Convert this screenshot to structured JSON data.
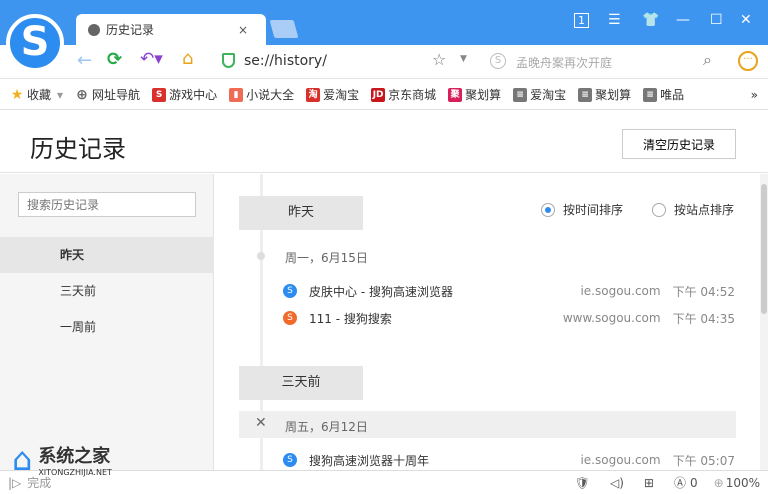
{
  "tab": {
    "title": "历史记录",
    "close": "×"
  },
  "window": {
    "tab_count": "1",
    "menu": "☰",
    "skin": "👕",
    "min": "—",
    "max": "☐",
    "close": "✕"
  },
  "address": {
    "url": "se://history/",
    "search_placeholder": "孟晚舟案再次开庭"
  },
  "bookmarks": [
    {
      "label": "收藏",
      "icon": "star-icon",
      "color": "#f2b01e",
      "glyph": "★"
    },
    {
      "label": "网址导航",
      "icon": "globe-icon",
      "color": "#666",
      "glyph": "⊕"
    },
    {
      "label": "游戏中心",
      "icon": "game-icon",
      "color": "#d9302c",
      "glyph": "S"
    },
    {
      "label": "小说大全",
      "icon": "novel-icon",
      "color": "#f06b55",
      "glyph": "▮"
    },
    {
      "label": "爱淘宝",
      "icon": "taobao-icon",
      "color": "#d9302c",
      "glyph": "淘"
    },
    {
      "label": "京东商城",
      "icon": "jd-icon",
      "color": "#c8161d",
      "glyph": "JD"
    },
    {
      "label": "聚划算",
      "icon": "juhuasuan-icon",
      "color": "#d81e5b",
      "glyph": "聚"
    },
    {
      "label": "爱淘宝",
      "icon": "page-icon",
      "color": "#777",
      "glyph": "≡"
    },
    {
      "label": "聚划算",
      "icon": "page-icon",
      "color": "#777",
      "glyph": "≡"
    },
    {
      "label": "唯品",
      "icon": "page-icon",
      "color": "#777",
      "glyph": "≡"
    }
  ],
  "more": "»",
  "page": {
    "title": "历史记录",
    "clear_button": "清空历史记录",
    "search_placeholder": "搜索历史记录"
  },
  "sidebar": [
    {
      "label": "昨天"
    },
    {
      "label": "三天前"
    },
    {
      "label": "一周前"
    }
  ],
  "sort": {
    "by_time": "按时间排序",
    "by_site": "按站点排序"
  },
  "groups": [
    {
      "label": "昨天",
      "date": "周一，6月15日",
      "items": [
        {
          "title": "皮肤中心 - 搜狗高速浏览器",
          "domain": "ie.sogou.com",
          "time": "下午 04:52"
        },
        {
          "title": "111 - 搜狗搜索",
          "domain": "www.sogou.com",
          "time": "下午 04:35"
        }
      ]
    },
    {
      "label": "三天前",
      "date": "周五，6月12日",
      "items": [
        {
          "title": "搜狗高速浏览器十周年",
          "domain": "ie.sogou.com",
          "time": "下午 05:07"
        }
      ]
    }
  ],
  "status": {
    "left": "完成",
    "adblock": "0",
    "zoom": "100%"
  },
  "watermark": {
    "title": "系统之家",
    "sub": "XITONGZHIJIA.NET"
  }
}
